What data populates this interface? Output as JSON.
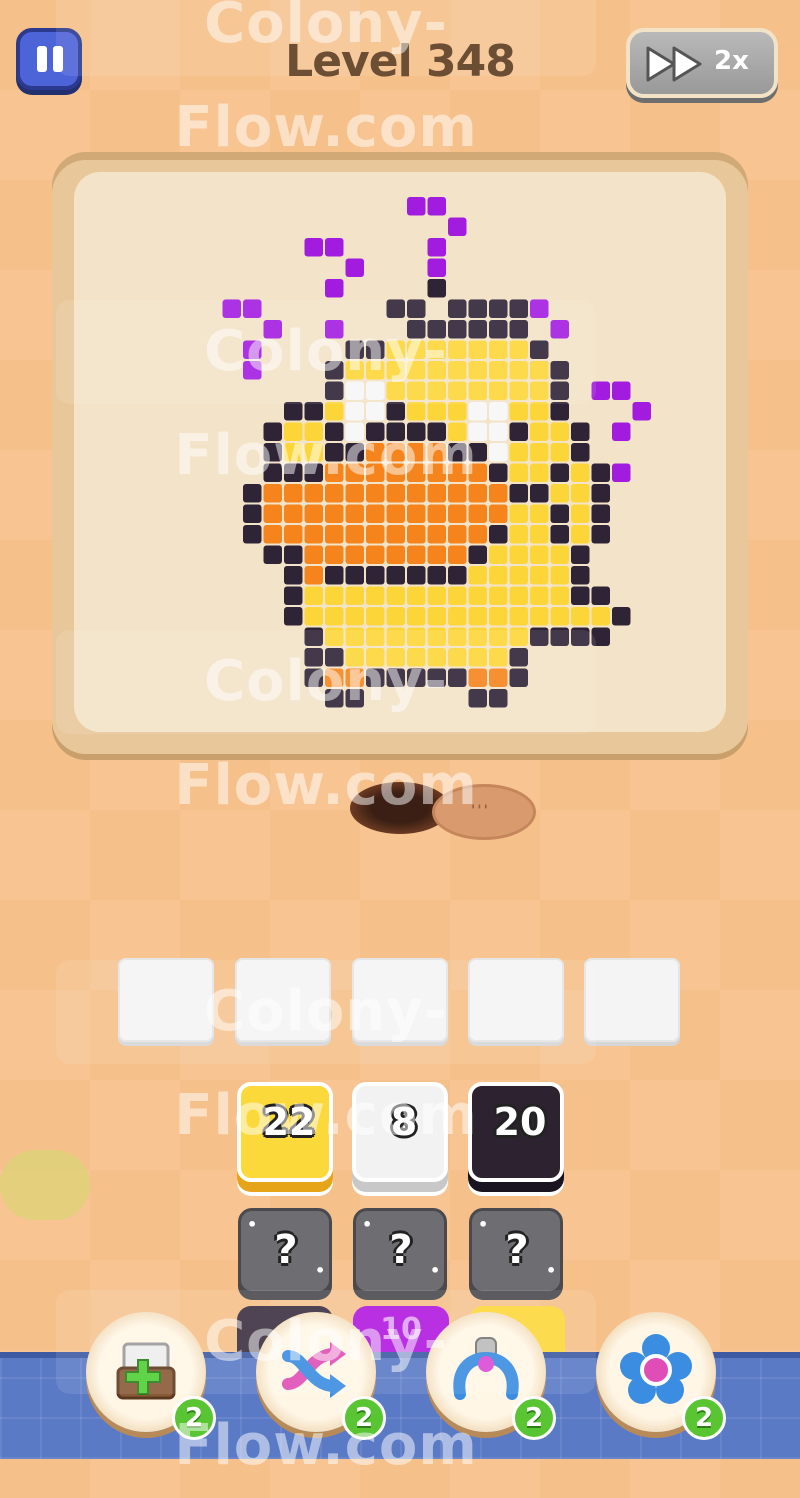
{
  "level_title": "Level 348",
  "speed_label": "2x",
  "watermark_text": "Colony-Flow.com",
  "queue_tiles": [
    {
      "count": "22",
      "color": "#fcd93a"
    },
    {
      "count": "8",
      "color": "#f2f2f2"
    },
    {
      "count": "20",
      "color": "#2d2330"
    }
  ],
  "mystery_tiles": [
    "?",
    "?",
    "?"
  ],
  "peek_tiles": [
    {
      "count": "",
      "color": "#3a2f40"
    },
    {
      "count": "10",
      "color": "#b119e0"
    },
    {
      "count": "",
      "color": "#fcd93a"
    }
  ],
  "boosters": [
    {
      "icon": "add-slot-icon",
      "count": "2"
    },
    {
      "icon": "shuffle-icon",
      "count": "2"
    },
    {
      "icon": "magnet-icon",
      "count": "2"
    },
    {
      "icon": "flower-icon",
      "count": "2"
    }
  ],
  "colors": {
    "purple": "#a21ce0",
    "outline": "#2f2336",
    "yellow": "#fcd638",
    "orange": "#f5841c",
    "white": "#f7f7f7"
  }
}
